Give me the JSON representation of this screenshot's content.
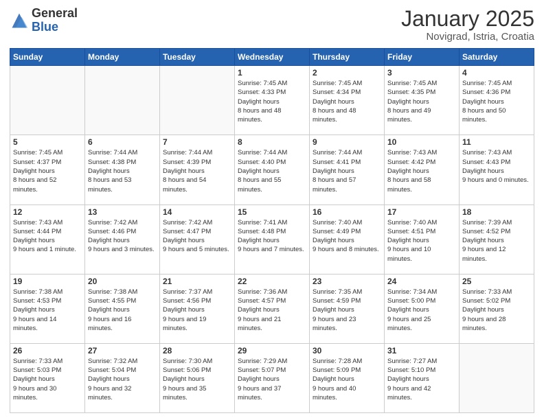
{
  "header": {
    "logo_general": "General",
    "logo_blue": "Blue",
    "month": "January 2025",
    "location": "Novigrad, Istria, Croatia"
  },
  "weekdays": [
    "Sunday",
    "Monday",
    "Tuesday",
    "Wednesday",
    "Thursday",
    "Friday",
    "Saturday"
  ],
  "weeks": [
    [
      {
        "day": "",
        "sunrise": "",
        "sunset": "",
        "daylight": ""
      },
      {
        "day": "",
        "sunrise": "",
        "sunset": "",
        "daylight": ""
      },
      {
        "day": "",
        "sunrise": "",
        "sunset": "",
        "daylight": ""
      },
      {
        "day": "1",
        "sunrise": "7:45 AM",
        "sunset": "4:33 PM",
        "daylight": "8 hours and 48 minutes."
      },
      {
        "day": "2",
        "sunrise": "7:45 AM",
        "sunset": "4:34 PM",
        "daylight": "8 hours and 48 minutes."
      },
      {
        "day": "3",
        "sunrise": "7:45 AM",
        "sunset": "4:35 PM",
        "daylight": "8 hours and 49 minutes."
      },
      {
        "day": "4",
        "sunrise": "7:45 AM",
        "sunset": "4:36 PM",
        "daylight": "8 hours and 50 minutes."
      }
    ],
    [
      {
        "day": "5",
        "sunrise": "7:45 AM",
        "sunset": "4:37 PM",
        "daylight": "8 hours and 52 minutes."
      },
      {
        "day": "6",
        "sunrise": "7:44 AM",
        "sunset": "4:38 PM",
        "daylight": "8 hours and 53 minutes."
      },
      {
        "day": "7",
        "sunrise": "7:44 AM",
        "sunset": "4:39 PM",
        "daylight": "8 hours and 54 minutes."
      },
      {
        "day": "8",
        "sunrise": "7:44 AM",
        "sunset": "4:40 PM",
        "daylight": "8 hours and 55 minutes."
      },
      {
        "day": "9",
        "sunrise": "7:44 AM",
        "sunset": "4:41 PM",
        "daylight": "8 hours and 57 minutes."
      },
      {
        "day": "10",
        "sunrise": "7:43 AM",
        "sunset": "4:42 PM",
        "daylight": "8 hours and 58 minutes."
      },
      {
        "day": "11",
        "sunrise": "7:43 AM",
        "sunset": "4:43 PM",
        "daylight": "9 hours and 0 minutes."
      }
    ],
    [
      {
        "day": "12",
        "sunrise": "7:43 AM",
        "sunset": "4:44 PM",
        "daylight": "9 hours and 1 minute."
      },
      {
        "day": "13",
        "sunrise": "7:42 AM",
        "sunset": "4:46 PM",
        "daylight": "9 hours and 3 minutes."
      },
      {
        "day": "14",
        "sunrise": "7:42 AM",
        "sunset": "4:47 PM",
        "daylight": "9 hours and 5 minutes."
      },
      {
        "day": "15",
        "sunrise": "7:41 AM",
        "sunset": "4:48 PM",
        "daylight": "9 hours and 7 minutes."
      },
      {
        "day": "16",
        "sunrise": "7:40 AM",
        "sunset": "4:49 PM",
        "daylight": "9 hours and 8 minutes."
      },
      {
        "day": "17",
        "sunrise": "7:40 AM",
        "sunset": "4:51 PM",
        "daylight": "9 hours and 10 minutes."
      },
      {
        "day": "18",
        "sunrise": "7:39 AM",
        "sunset": "4:52 PM",
        "daylight": "9 hours and 12 minutes."
      }
    ],
    [
      {
        "day": "19",
        "sunrise": "7:38 AM",
        "sunset": "4:53 PM",
        "daylight": "9 hours and 14 minutes."
      },
      {
        "day": "20",
        "sunrise": "7:38 AM",
        "sunset": "4:55 PM",
        "daylight": "9 hours and 16 minutes."
      },
      {
        "day": "21",
        "sunrise": "7:37 AM",
        "sunset": "4:56 PM",
        "daylight": "9 hours and 19 minutes."
      },
      {
        "day": "22",
        "sunrise": "7:36 AM",
        "sunset": "4:57 PM",
        "daylight": "9 hours and 21 minutes."
      },
      {
        "day": "23",
        "sunrise": "7:35 AM",
        "sunset": "4:59 PM",
        "daylight": "9 hours and 23 minutes."
      },
      {
        "day": "24",
        "sunrise": "7:34 AM",
        "sunset": "5:00 PM",
        "daylight": "9 hours and 25 minutes."
      },
      {
        "day": "25",
        "sunrise": "7:33 AM",
        "sunset": "5:02 PM",
        "daylight": "9 hours and 28 minutes."
      }
    ],
    [
      {
        "day": "26",
        "sunrise": "7:33 AM",
        "sunset": "5:03 PM",
        "daylight": "9 hours and 30 minutes."
      },
      {
        "day": "27",
        "sunrise": "7:32 AM",
        "sunset": "5:04 PM",
        "daylight": "9 hours and 32 minutes."
      },
      {
        "day": "28",
        "sunrise": "7:30 AM",
        "sunset": "5:06 PM",
        "daylight": "9 hours and 35 minutes."
      },
      {
        "day": "29",
        "sunrise": "7:29 AM",
        "sunset": "5:07 PM",
        "daylight": "9 hours and 37 minutes."
      },
      {
        "day": "30",
        "sunrise": "7:28 AM",
        "sunset": "5:09 PM",
        "daylight": "9 hours and 40 minutes."
      },
      {
        "day": "31",
        "sunrise": "7:27 AM",
        "sunset": "5:10 PM",
        "daylight": "9 hours and 42 minutes."
      },
      {
        "day": "",
        "sunrise": "",
        "sunset": "",
        "daylight": ""
      }
    ]
  ],
  "labels": {
    "sunrise": "Sunrise:",
    "sunset": "Sunset:",
    "daylight": "Daylight hours"
  }
}
